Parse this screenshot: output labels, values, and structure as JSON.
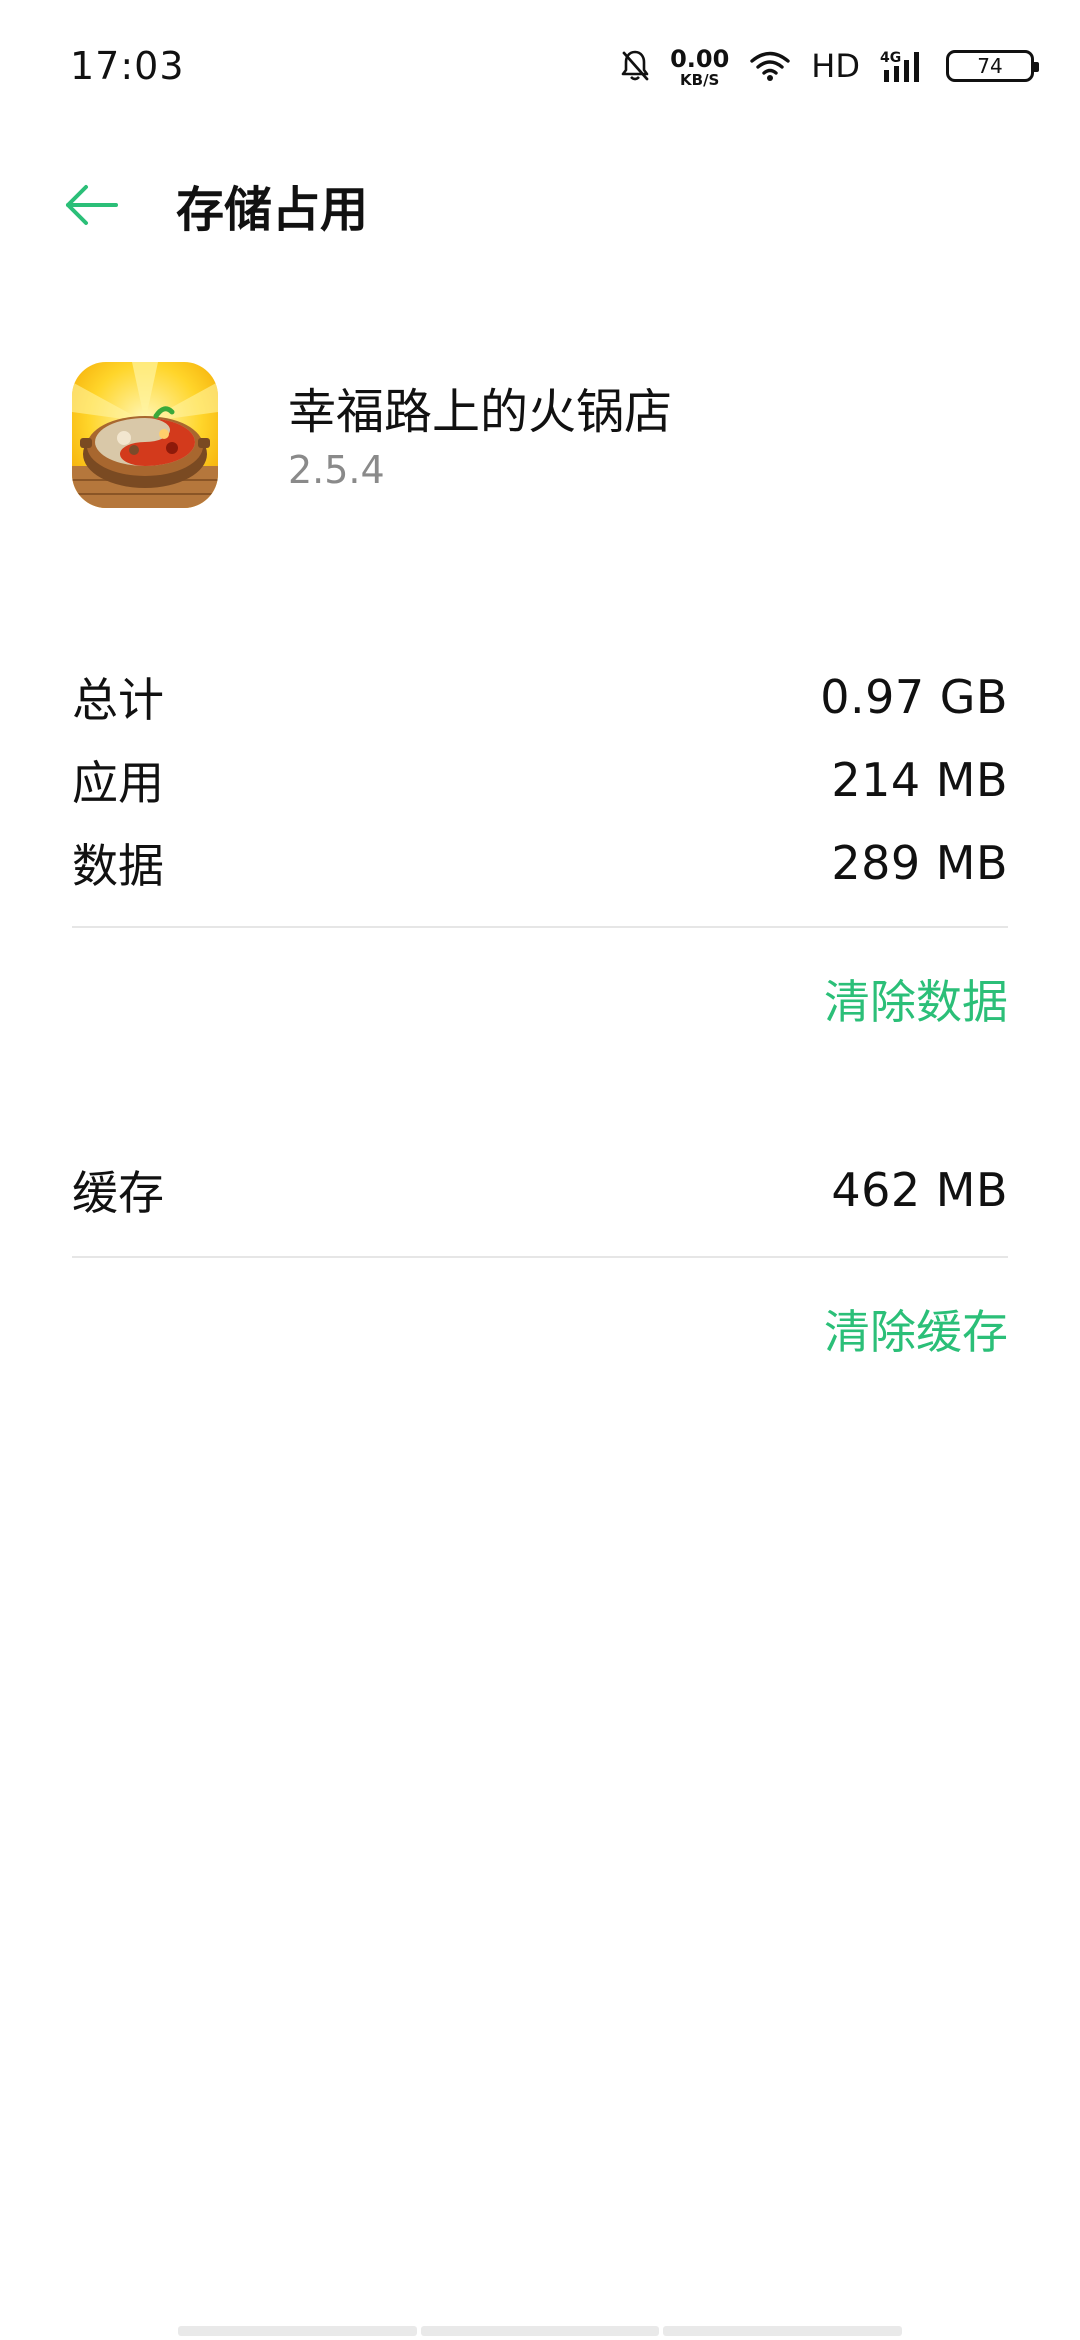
{
  "status_bar": {
    "time": "17:03",
    "net_speed_value": "0.00",
    "net_speed_unit": "KB/S",
    "hd_label": "HD",
    "network_type": "4G",
    "battery_level": "74",
    "icons": [
      "bell-mute-icon",
      "wifi-icon",
      "signal-icon",
      "battery-icon"
    ]
  },
  "header": {
    "back_icon": "arrow-left-icon",
    "title": "存储占用"
  },
  "app": {
    "name": "幸福路上的火锅店",
    "version": "2.5.4",
    "icon": "hotpot-app-icon"
  },
  "storage": {
    "total_label": "总计",
    "total_value": "0.97 GB",
    "app_label": "应用",
    "app_value": "214 MB",
    "data_label": "数据",
    "data_value": "289 MB",
    "clear_data_label": "清除数据",
    "cache_label": "缓存",
    "cache_value": "462 MB",
    "clear_cache_label": "清除缓存"
  },
  "colors": {
    "accent": "#2bbf78",
    "text_primary": "#111111",
    "text_secondary": "#8a8a8a",
    "divider": "#e6e6e6"
  }
}
